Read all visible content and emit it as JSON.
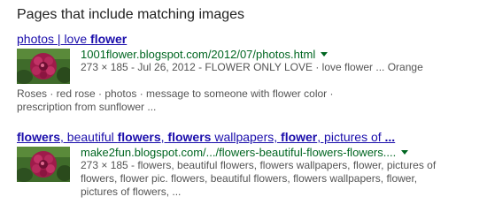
{
  "section": {
    "heading": "Pages that include matching images"
  },
  "results": [
    {
      "title_parts": [
        {
          "text": "photos | love ",
          "bold": false
        },
        {
          "text": "flower",
          "bold": true
        }
      ],
      "url": "1001flower.blogspot.com/2012/07/photos.html",
      "snippet_lines": [
        "273 × 185 - Jul 26, 2012 - FLOWER ONLY LOVE · love flower ... Orange",
        "Roses · red rose · photos · message to someone with flower color ·",
        "prescription from sunflower ..."
      ],
      "thumbnail_icon": "flower-thumbnail"
    },
    {
      "title_parts": [
        {
          "text": "flowers",
          "bold": true
        },
        {
          "text": ", beautiful ",
          "bold": false
        },
        {
          "text": "flowers",
          "bold": true
        },
        {
          "text": ", ",
          "bold": false
        },
        {
          "text": "flowers",
          "bold": true
        },
        {
          "text": " wallpapers, ",
          "bold": false
        },
        {
          "text": "flower",
          "bold": true
        },
        {
          "text": ", pictures of ",
          "bold": false
        },
        {
          "text": "...",
          "bold": true
        }
      ],
      "url": "make2fun.blogspot.com/.../flowers-beautiful-flowers-flowers....",
      "snippet_lines": [
        "273 × 185 - flowers, beautiful flowers, flowers wallpapers, flower, pictures of",
        "flowers, flower pic. flowers, beautiful flowers, flowers wallpapers, flower,",
        "pictures of flowers, ..."
      ],
      "thumbnail_icon": "flower-thumbnail"
    }
  ],
  "colors": {
    "link": "#1a0dab",
    "url": "#006621",
    "snippet": "#545454",
    "heading": "#222222"
  }
}
